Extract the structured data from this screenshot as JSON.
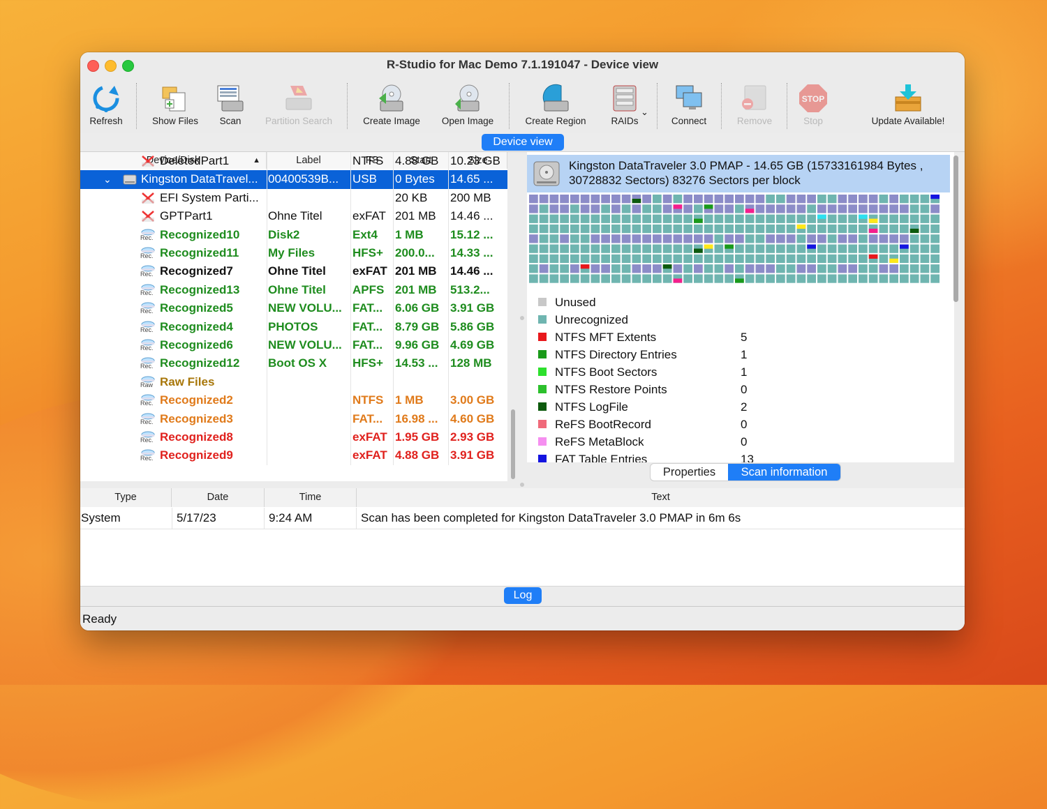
{
  "window": {
    "title": "R-Studio for Mac Demo 7.1.191047 - Device view"
  },
  "toolbar": [
    {
      "label": "Refresh",
      "icon": "refresh-icon",
      "enabled": true
    },
    {
      "label": "Show Files",
      "icon": "show-files-icon",
      "enabled": true
    },
    {
      "label": "Scan",
      "icon": "scan-icon",
      "enabled": true
    },
    {
      "label": "Partition Search",
      "icon": "partition-search-icon",
      "enabled": false
    },
    {
      "label": "Create Image",
      "icon": "create-image-icon",
      "enabled": true
    },
    {
      "label": "Open Image",
      "icon": "open-image-icon",
      "enabled": true
    },
    {
      "label": "Create Region",
      "icon": "create-region-icon",
      "enabled": true
    },
    {
      "label": "RAIDs",
      "icon": "raids-icon",
      "enabled": true
    },
    {
      "label": "Connect",
      "icon": "connect-icon",
      "enabled": true
    },
    {
      "label": "Remove",
      "icon": "remove-icon",
      "enabled": false
    },
    {
      "label": "Stop",
      "icon": "stop-icon",
      "enabled": false
    },
    {
      "label": "Update Available!",
      "icon": "update-icon",
      "enabled": true
    }
  ],
  "stop_icon_text": "STOP",
  "view_tab": "Device view",
  "device_table": {
    "columns": [
      "Device/Disk",
      "Label",
      "FS",
      "Start",
      "Size"
    ],
    "rows": [
      {
        "name": "DeletedPart1",
        "label": "",
        "fs": "NTFS",
        "start": "4.88 GB",
        "size": "10.23 GB",
        "style": "black",
        "icon": "deleted-partition-icon"
      },
      {
        "name": "Kingston DataTravel...",
        "label": "00400539B...",
        "fs": "USB",
        "start": "0 Bytes",
        "size": "14.65 ...",
        "style": "sel",
        "icon": "usb-drive-icon"
      },
      {
        "name": "EFI System Parti...",
        "label": "",
        "fs": "",
        "start": "20 KB",
        "size": "200 MB",
        "style": "black",
        "icon": "deleted-partition-icon"
      },
      {
        "name": "GPTPart1",
        "label": "Ohne Titel",
        "fs": "exFAT",
        "start": "201 MB",
        "size": "14.46 ...",
        "style": "black",
        "icon": "deleted-partition-icon"
      },
      {
        "name": "Recognized10",
        "label": "Disk2",
        "fs": "Ext4",
        "start": "1 MB",
        "size": "15.12 ...",
        "style": "green",
        "icon": "recognized-icon",
        "tag": "Rec."
      },
      {
        "name": "Recognized11",
        "label": "My Files",
        "fs": "HFS+",
        "start": "200.0...",
        "size": "14.33 ...",
        "style": "green",
        "icon": "recognized-icon",
        "tag": "Rec."
      },
      {
        "name": "Recognized7",
        "label": "Ohne Titel",
        "fs": "exFAT",
        "start": "201 MB",
        "size": "14.46 ...",
        "style": "boldblack",
        "icon": "recognized-icon",
        "tag": "Rec."
      },
      {
        "name": "Recognized13",
        "label": "Ohne Titel",
        "fs": "APFS",
        "start": "201 MB",
        "size": "513.2...",
        "style": "green",
        "icon": "recognized-icon",
        "tag": "Rec."
      },
      {
        "name": "Recognized5",
        "label": "NEW VOLU...",
        "fs": "FAT...",
        "start": "6.06 GB",
        "size": "3.91 GB",
        "style": "green",
        "icon": "recognized-icon",
        "tag": "Rec."
      },
      {
        "name": "Recognized4",
        "label": "PHOTOS",
        "fs": "FAT...",
        "start": "8.79 GB",
        "size": "5.86 GB",
        "style": "green",
        "icon": "recognized-icon",
        "tag": "Rec."
      },
      {
        "name": "Recognized6",
        "label": "NEW VOLU...",
        "fs": "FAT...",
        "start": "9.96 GB",
        "size": "4.69 GB",
        "style": "green",
        "icon": "recognized-icon",
        "tag": "Rec."
      },
      {
        "name": "Recognized12",
        "label": "Boot OS X",
        "fs": "HFS+",
        "start": "14.53 ...",
        "size": "128 MB",
        "style": "green",
        "icon": "recognized-icon",
        "tag": "Rec."
      },
      {
        "name": "Raw Files",
        "label": "",
        "fs": "",
        "start": "",
        "size": "",
        "style": "olive",
        "icon": "raw-files-icon",
        "tag": "Raw"
      },
      {
        "name": "Recognized2",
        "label": "",
        "fs": "NTFS",
        "start": "1 MB",
        "size": "3.00 GB",
        "style": "orange",
        "icon": "recognized-icon",
        "tag": "Rec."
      },
      {
        "name": "Recognized3",
        "label": "",
        "fs": "FAT...",
        "start": "16.98 ...",
        "size": "4.60 GB",
        "style": "orange",
        "icon": "recognized-icon",
        "tag": "Rec."
      },
      {
        "name": "Recognized8",
        "label": "",
        "fs": "exFAT",
        "start": "1.95 GB",
        "size": "2.93 GB",
        "style": "red",
        "icon": "recognized-icon",
        "tag": "Rec."
      },
      {
        "name": "Recognized9",
        "label": "",
        "fs": "exFAT",
        "start": "4.88 GB",
        "size": "3.91 GB",
        "style": "red",
        "icon": "recognized-icon",
        "tag": "Rec."
      }
    ]
  },
  "scan_panel": {
    "header": "Kingston DataTraveler 3.0 PMAP - 14.65 GB (15733161984 Bytes , 30728832 Sectors) 83276 Sectors per block",
    "legend": [
      {
        "name": "Unused",
        "color": "#c8c8c8",
        "value": ""
      },
      {
        "name": "Unrecognized",
        "color": "#6fb5b0",
        "value": ""
      },
      {
        "name": "NTFS MFT Extents",
        "color": "#e8181c",
        "value": "5"
      },
      {
        "name": "NTFS Directory Entries",
        "color": "#1a9a1a",
        "value": "1"
      },
      {
        "name": "NTFS Boot Sectors",
        "color": "#2de02d",
        "value": "1"
      },
      {
        "name": "NTFS Restore Points",
        "color": "#2cc02c",
        "value": "0"
      },
      {
        "name": "NTFS LogFile",
        "color": "#0d5a0d",
        "value": "2"
      },
      {
        "name": "ReFS BootRecord",
        "color": "#f06a7a",
        "value": "0"
      },
      {
        "name": "ReFS MetaBlock",
        "color": "#f58ff0",
        "value": "0"
      },
      {
        "name": "FAT Table Entries",
        "color": "#1414e0",
        "value": "13"
      }
    ],
    "tabs": [
      "Properties",
      "Scan information"
    ]
  },
  "log": {
    "columns": [
      "Type",
      "Date",
      "Time",
      "Text"
    ],
    "rows": [
      {
        "type": "System",
        "date": "5/17/23",
        "time": "9:24 AM",
        "text": "Scan has been completed for Kingston DataTraveler 3.0 PMAP in 6m 6s"
      }
    ],
    "tab": "Log"
  },
  "status": "Ready",
  "colors": {
    "accent": "#1f7ef7",
    "selection": "#0a62d8"
  }
}
